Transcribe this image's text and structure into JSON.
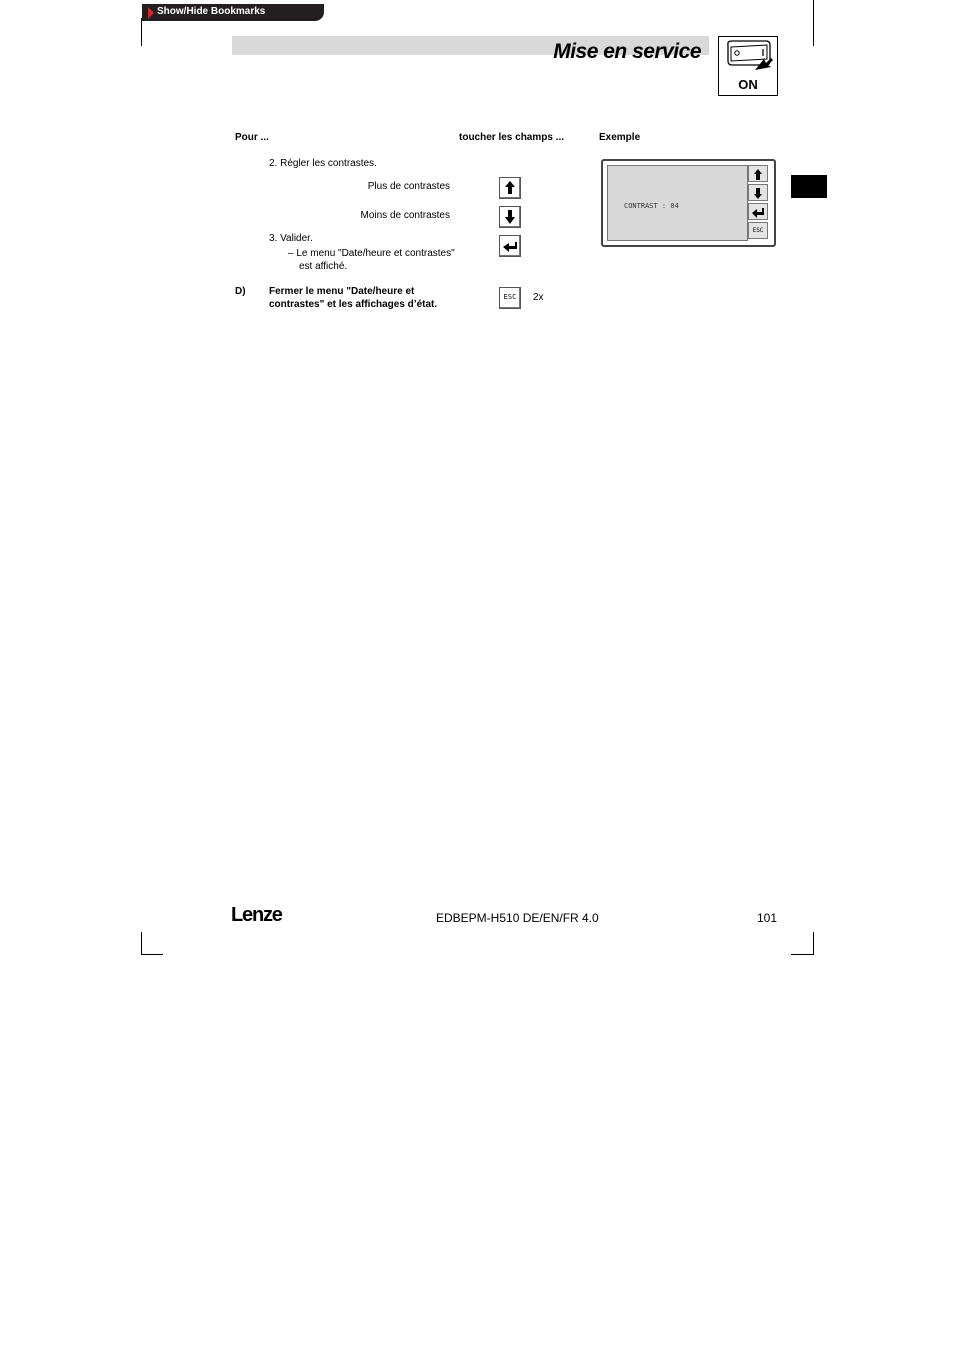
{
  "toolbar": {
    "bookmarks_label": "Show/Hide Bookmarks"
  },
  "header": {
    "title": "Mise en service",
    "badge_text": "ON"
  },
  "columns": {
    "col1": "Pour ...",
    "col2": "toucher les champs ...",
    "col3": "Exemple"
  },
  "steps": {
    "step2": "2.  Régler les contrastes.",
    "more_contrast": "Plus de contrastes",
    "less_contrast": "Moins de contrastes",
    "step3": "3.  Valider.",
    "step3_note_line1": "– Le menu \"Date/heure et contrastes\"",
    "step3_note_line2": "est affiché.",
    "d_label": "D)",
    "d_text_line1": "Fermer le menu \"Date/heure et",
    "d_text_line2": "contrastes\" et les affichages d’état.",
    "repeat": "2x"
  },
  "keys": {
    "esc_label": "ESC"
  },
  "example": {
    "display_text": "CONTRAST : 04"
  },
  "footer": {
    "logo": "Lenze",
    "doc_code": "EDBEPM-H510 DE/EN/FR 4.0",
    "page_number": "101"
  }
}
